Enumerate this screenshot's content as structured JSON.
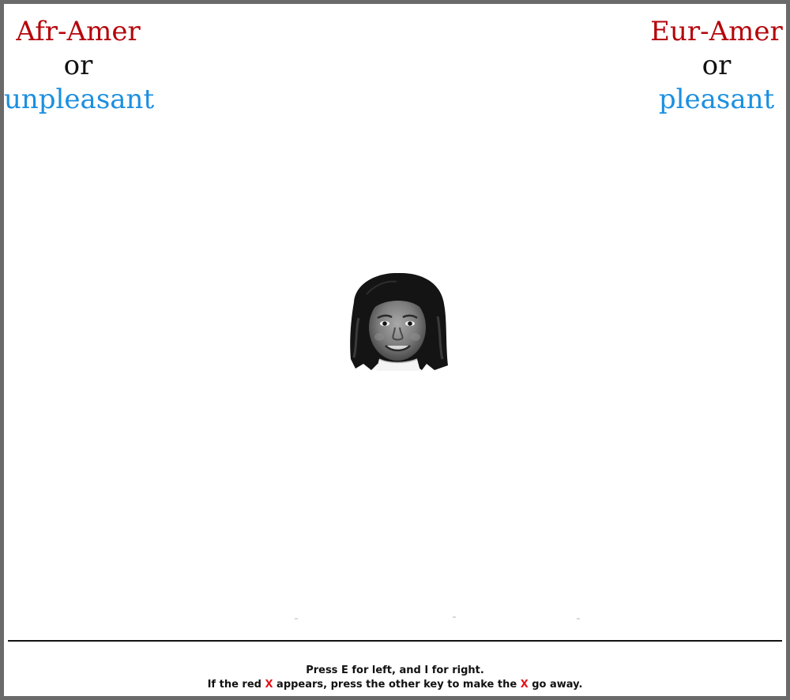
{
  "left_category": {
    "line1": "Afr-Amer",
    "line2": "or",
    "line3": "unpleasant"
  },
  "right_category": {
    "line1": "Eur-Amer",
    "line2": "or",
    "line3": "pleasant"
  },
  "stimulus": {
    "icon": "child-face-photo-icon"
  },
  "instructions": {
    "line1": "Press E for left, and I for right.",
    "line2_part1": "If the red ",
    "line2_x": "X",
    "line2_part2": " appears, press the other key to make the ",
    "line2_x2": "X",
    "line2_part3": " go away."
  },
  "colors": {
    "group_label": "#b5050b",
    "connector": "#111111",
    "attribute_label": "#1b8fe0",
    "error_x": "#e5121a",
    "frame_border": "#6a6a6a"
  }
}
